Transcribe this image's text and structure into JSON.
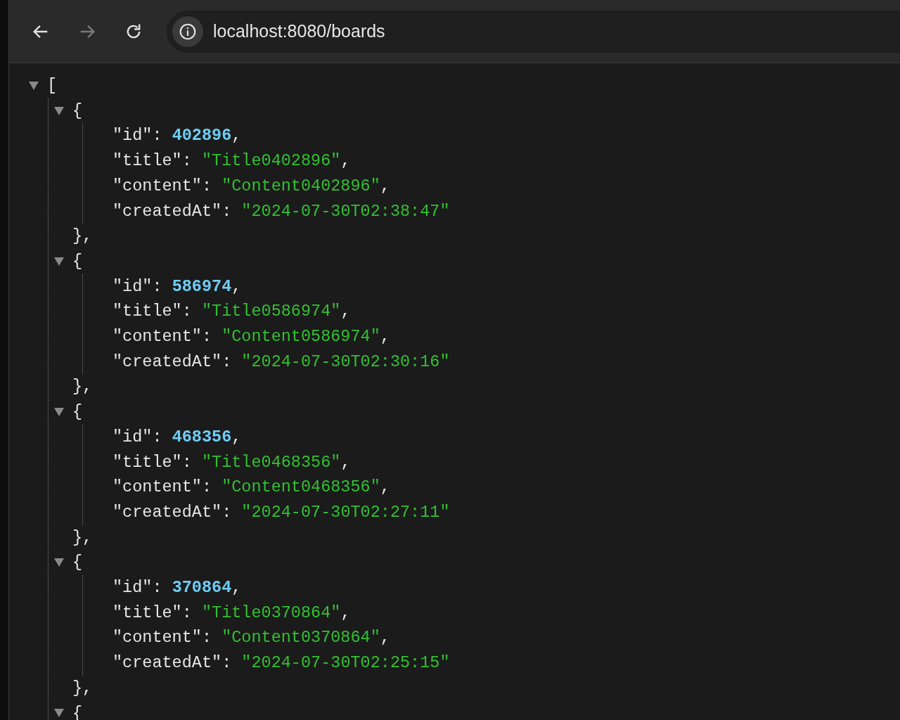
{
  "toolbar": {
    "back_disabled": false,
    "forward_disabled": true,
    "url": "localhost:8080/boards"
  },
  "viewer": {
    "expanded": true,
    "open": "[",
    "items": [
      {
        "expanded": true,
        "open": "{",
        "fields": [
          {
            "key": "\"id\"",
            "colon": ":",
            "value": "402896",
            "kind": "number",
            "comma": ","
          },
          {
            "key": "\"title\"",
            "colon": ":",
            "value": "\"Title0402896\"",
            "kind": "string",
            "comma": ","
          },
          {
            "key": "\"content\"",
            "colon": ":",
            "value": "\"Content0402896\"",
            "kind": "string",
            "comma": ","
          },
          {
            "key": "\"createdAt\"",
            "colon": ":",
            "value": "\"2024-07-30T02:38:47\"",
            "kind": "string"
          }
        ],
        "close": "},"
      },
      {
        "expanded": true,
        "open": "{",
        "fields": [
          {
            "key": "\"id\"",
            "colon": ":",
            "value": "586974",
            "kind": "number",
            "comma": ","
          },
          {
            "key": "\"title\"",
            "colon": ":",
            "value": "\"Title0586974\"",
            "kind": "string",
            "comma": ","
          },
          {
            "key": "\"content\"",
            "colon": ":",
            "value": "\"Content0586974\"",
            "kind": "string",
            "comma": ","
          },
          {
            "key": "\"createdAt\"",
            "colon": ":",
            "value": "\"2024-07-30T02:30:16\"",
            "kind": "string"
          }
        ],
        "close": "},"
      },
      {
        "expanded": true,
        "open": "{",
        "fields": [
          {
            "key": "\"id\"",
            "colon": ":",
            "value": "468356",
            "kind": "number",
            "comma": ","
          },
          {
            "key": "\"title\"",
            "colon": ":",
            "value": "\"Title0468356\"",
            "kind": "string",
            "comma": ","
          },
          {
            "key": "\"content\"",
            "colon": ":",
            "value": "\"Content0468356\"",
            "kind": "string",
            "comma": ","
          },
          {
            "key": "\"createdAt\"",
            "colon": ":",
            "value": "\"2024-07-30T02:27:11\"",
            "kind": "string"
          }
        ],
        "close": "},"
      },
      {
        "expanded": true,
        "open": "{",
        "fields": [
          {
            "key": "\"id\"",
            "colon": ":",
            "value": "370864",
            "kind": "number",
            "comma": ","
          },
          {
            "key": "\"title\"",
            "colon": ":",
            "value": "\"Title0370864\"",
            "kind": "string",
            "comma": ","
          },
          {
            "key": "\"content\"",
            "colon": ":",
            "value": "\"Content0370864\"",
            "kind": "string",
            "comma": ","
          },
          {
            "key": "\"createdAt\"",
            "colon": ":",
            "value": "\"2024-07-30T02:25:15\"",
            "kind": "string"
          }
        ],
        "close": "},"
      },
      {
        "expanded": true,
        "open": "{"
      }
    ]
  }
}
